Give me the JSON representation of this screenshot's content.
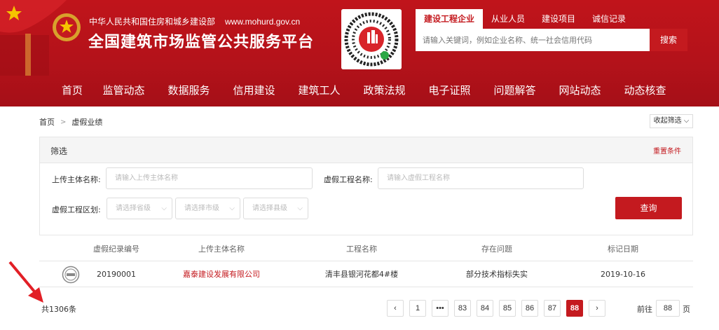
{
  "header": {
    "subtitle": "中华人民共和国住房和城乡建设部",
    "domain": "www.mohurd.gov.cn",
    "title": "全国建筑市场监管公共服务平台"
  },
  "search": {
    "tabs": [
      "建设工程企业",
      "从业人员",
      "建设项目",
      "诚信记录"
    ],
    "active_tab": 0,
    "placeholder": "请输入关键词，例如企业名称、统一社会信用代码",
    "button": "搜索"
  },
  "nav": [
    "首页",
    "监管动态",
    "数据服务",
    "信用建设",
    "建筑工人",
    "政策法规",
    "电子证照",
    "问题解答",
    "网站动态",
    "动态核查"
  ],
  "breadcrumb": {
    "home": "首页",
    "current": "虚假业绩"
  },
  "collapse_filter": "收起筛选",
  "filter": {
    "title": "筛选",
    "reset": "重置条件",
    "uploader_label": "上传主体名称:",
    "uploader_placeholder": "请输入上传主体名称",
    "project_label": "虚假工程名称:",
    "project_placeholder": "请输入虚假工程名称",
    "region_label": "虚假工程区划:",
    "province": "请选择省级",
    "city": "请选择市级",
    "county": "请选择县级",
    "query": "查询"
  },
  "table": {
    "headers": [
      "虚假纪录编号",
      "上传主体名称",
      "工程名称",
      "存在问题",
      "标记日期"
    ],
    "rows": [
      {
        "id": "20190001",
        "uploader": "嘉泰建设发展有限公司",
        "project": "清丰县银河花都4#楼",
        "issue": "部分技术指标失实",
        "date": "2019-10-16"
      }
    ]
  },
  "total": "共1306条",
  "pagination": {
    "pages": [
      "1",
      "•••",
      "83",
      "84",
      "85",
      "86",
      "87",
      "88"
    ],
    "current": "88",
    "goto_label": "前往",
    "goto_value": "88",
    "goto_unit": "页"
  },
  "colors": {
    "brand_red": "#c41a1f",
    "header_red": "#b3121a"
  },
  "icons": [
    "emblem-icon",
    "qr-code-icon",
    "chevron-right-icon",
    "chevron-left-icon",
    "chevron-down-icon",
    "stamp-icon",
    "annotation-arrow-icon"
  ]
}
